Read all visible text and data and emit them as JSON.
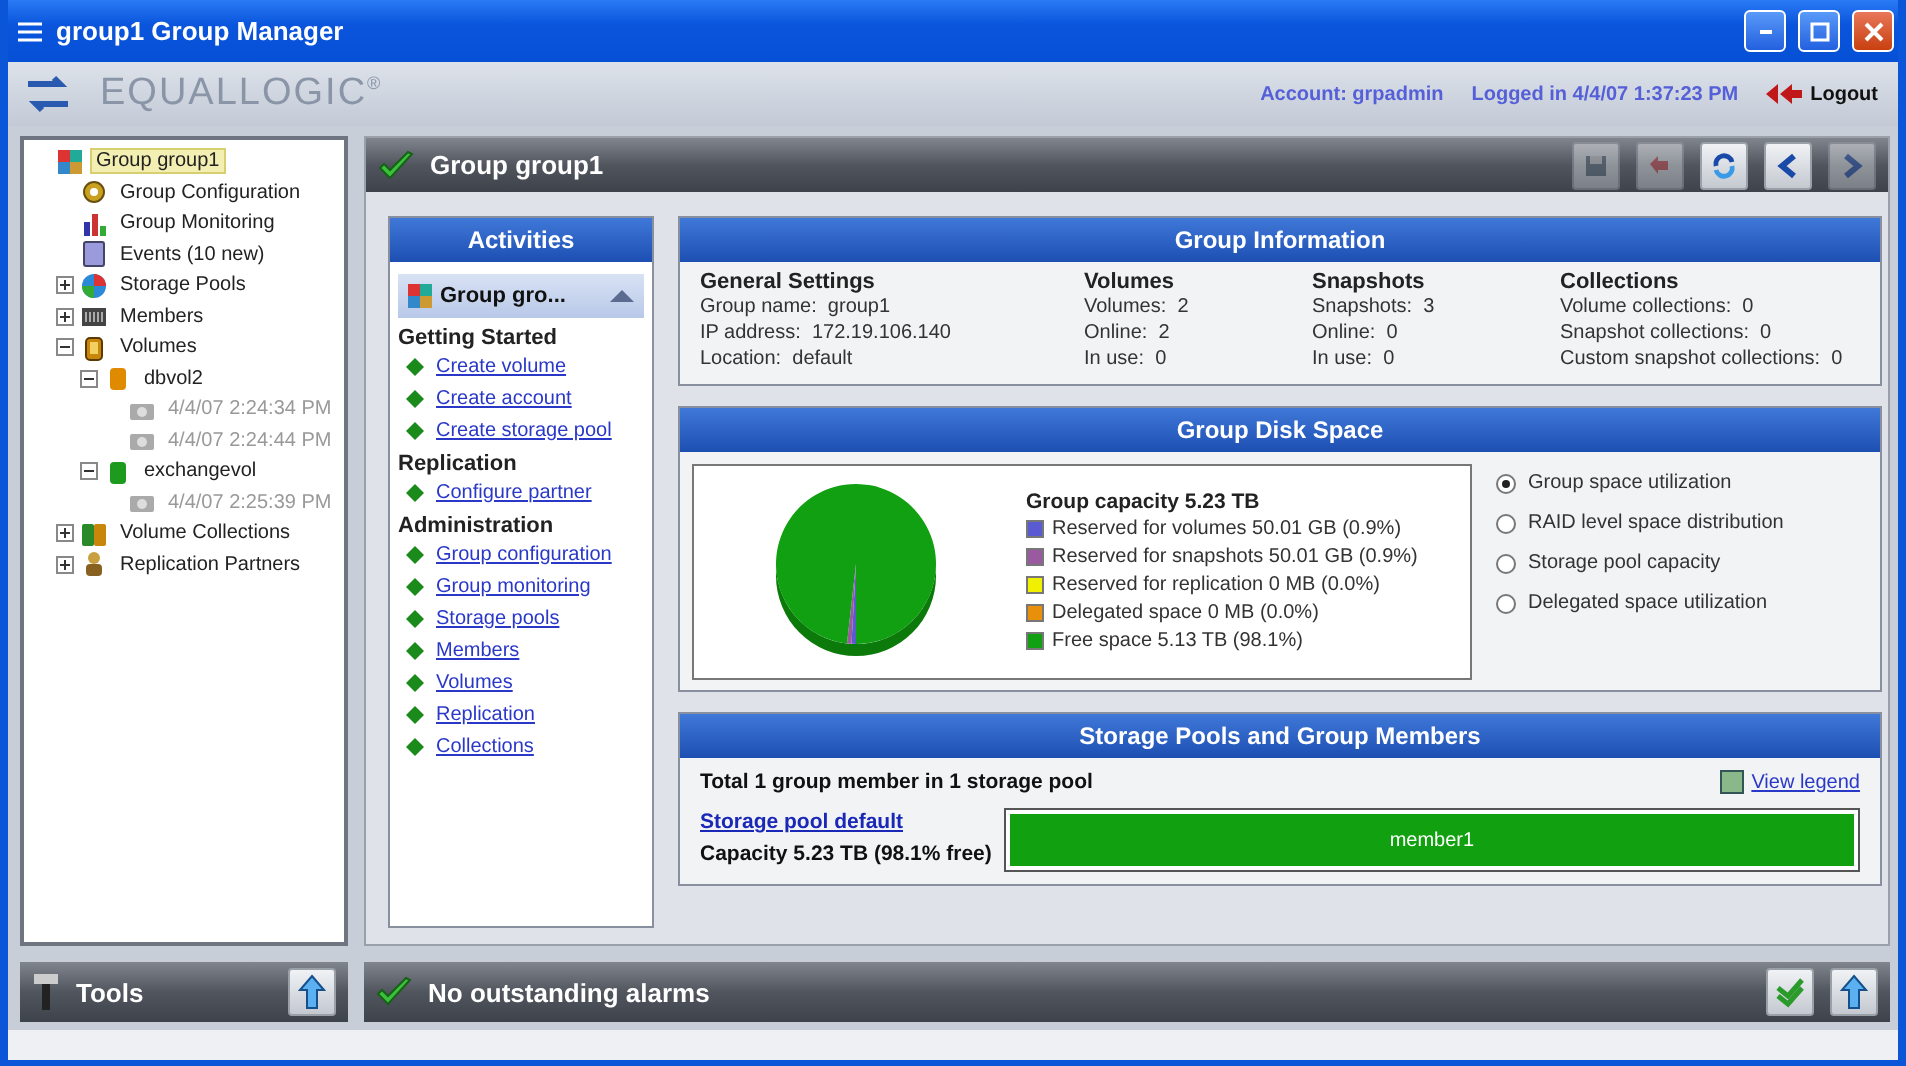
{
  "window": {
    "title": "group1 Group Manager"
  },
  "header": {
    "logo": "EQUALLOGIC$^{®}$",
    "account": "Account: grpadmin",
    "logged_in": "Logged in 4/4/07 1:37:23 PM",
    "logout": "Logout"
  },
  "tree": [
    {
      "label": "Group group1",
      "kind": "group",
      "selected": true,
      "children": [
        {
          "label": "Group Configuration",
          "kind": "config",
          "selected": false
        },
        {
          "label": "Group Monitoring",
          "kind": "monitor",
          "selected": false
        },
        {
          "label": "Events (10 new)",
          "kind": "events",
          "selected": false
        },
        {
          "label": "Storage Pools",
          "kind": "pools",
          "selected": false,
          "expanded": false
        },
        {
          "label": "Members",
          "kind": "members",
          "selected": false,
          "expanded": false
        },
        {
          "label": "Volumes",
          "kind": "volumes",
          "selected": false,
          "expanded": true,
          "children": [
            {
              "label": "dbvol2",
              "kind": "volume",
              "color": "#e08a00",
              "selected": false,
              "expanded": true,
              "children": [
                {
                  "label": "4/4/07 2:24:34 PM",
                  "kind": "snapshot",
                  "selected": false
                },
                {
                  "label": "4/4/07 2:24:44 PM",
                  "kind": "snapshot",
                  "selected": false
                }
              ]
            },
            {
              "label": "exchangevol",
              "kind": "volume",
              "color": "#1e9a1e",
              "selected": false,
              "expanded": true,
              "children": [
                {
                  "label": "4/4/07 2:25:39 PM",
                  "kind": "snapshot",
                  "selected": false
                }
              ]
            }
          ]
        },
        {
          "label": "Volume Collections",
          "kind": "collections",
          "selected": false,
          "expanded": false
        },
        {
          "label": "Replication Partners",
          "kind": "partners",
          "selected": false,
          "expanded": false
        }
      ]
    }
  ],
  "main": {
    "title": "Group group1",
    "toolbar": [
      {
        "kind": "save",
        "disabled": true
      },
      {
        "kind": "undo",
        "disabled": true
      },
      {
        "kind": "refresh",
        "disabled": false
      },
      {
        "kind": "back",
        "disabled": false
      },
      {
        "kind": "forward",
        "disabled": true
      }
    ]
  },
  "activities": {
    "title": "Activities",
    "selector": "Group gro...",
    "sections": [
      {
        "title": "Getting Started",
        "links": [
          "Create volume",
          "Create account",
          "Create storage pool"
        ]
      },
      {
        "title": "Replication",
        "links": [
          "Configure partner"
        ]
      },
      {
        "title": "Administration",
        "links": [
          "Group configuration",
          "Group monitoring",
          "Storage pools",
          "Members",
          "Volumes",
          "Replication",
          "Collections"
        ]
      }
    ]
  },
  "group_info": {
    "title": "Group Information",
    "columns": [
      {
        "heading": "General Settings",
        "lines": [
          "Group name:  group1",
          "IP address:  172.19.106.140",
          "Location:  default"
        ]
      },
      {
        "heading": "Volumes",
        "lines": [
          "Volumes:  2",
          "Online:  2",
          "In use:  0"
        ]
      },
      {
        "heading": "Snapshots",
        "lines": [
          "Snapshots:  3",
          "Online:  0",
          "In use:  0"
        ]
      },
      {
        "heading": "Collections",
        "lines": [
          "Volume collections:  0",
          "Snapshot collections:  0",
          "Custom snapshot collections:  0"
        ]
      }
    ]
  },
  "disk_space": {
    "title": "Group Disk Space",
    "chart_data": {
      "type": "pie",
      "title": "Group capacity 5.23 TB",
      "categories": [
        "Reserved for volumes 50.01 GB (0.9%)",
        "Reserved for snapshots 50.01 GB (0.9%)",
        "Reserved for replication 0 MB (0.0%)",
        "Delegated space 0 MB (0.0%)",
        "Free space 5.13 TB (98.1%)"
      ],
      "values": [
        0.9,
        0.9,
        0.0,
        0.0,
        98.1
      ],
      "colors": [
        "#5a5ad2",
        "#9a5aa0",
        "#f0f000",
        "#e8900a",
        "#11a011"
      ]
    },
    "options": [
      {
        "label": "Group space utilization",
        "selected": true
      },
      {
        "label": "RAID level space distribution",
        "selected": false
      },
      {
        "label": "Storage pool capacity",
        "selected": false
      },
      {
        "label": "Delegated space utilization",
        "selected": false
      }
    ]
  },
  "storage": {
    "title": "Storage Pools and Group Members",
    "summary": "Total 1 group member in 1 storage pool",
    "legend_link": "View legend",
    "pool": "Storage pool default",
    "capacity": "Capacity 5.23 TB (98.1% free)",
    "members": [
      {
        "label": "member1"
      }
    ]
  },
  "tools": {
    "label": "Tools"
  },
  "alarms": {
    "text": "No outstanding alarms"
  }
}
